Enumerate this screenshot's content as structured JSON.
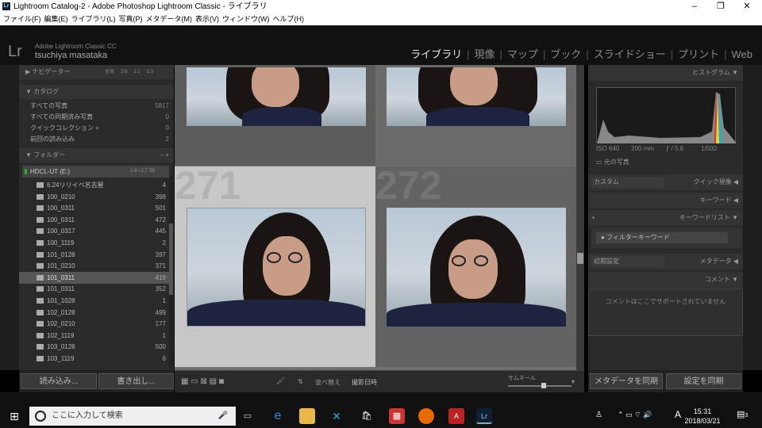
{
  "window": {
    "title": "Lightroom Catalog-2 - Adobe Photoshop Lightroom Classic - ライブラリ",
    "icon_text": "Lr"
  },
  "menu": [
    "ファイル(F)",
    "編集(E)",
    "ライブラリ(L)",
    "写真(P)",
    "メタデータ(M)",
    "表示(V)",
    "ウィンドウ(W)",
    "ヘルプ(H)"
  ],
  "identity": {
    "logo": "Lr",
    "product": "Adobe Lightroom Classic CC",
    "user": "tsuchiya masataka"
  },
  "modules": [
    "ライブラリ",
    "現像",
    "マップ",
    "ブック",
    "スライドショー",
    "プリント",
    "Web"
  ],
  "left": {
    "navigator": "ナビゲーター",
    "nav_zoom": [
      "全体",
      "3:6",
      "1:1",
      "1:3"
    ],
    "catalog_header": "カタログ",
    "catalog": [
      {
        "label": "すべての写真",
        "count": "5817"
      },
      {
        "label": "すべての同期済み写真",
        "count": "0"
      },
      {
        "label": "クイックコレクション +",
        "count": "0"
      },
      {
        "label": "前回の読み込み",
        "count": "2"
      }
    ],
    "folders_header": "フォルダー",
    "volume": {
      "name": "HDCL-UT (E:)",
      "space": "1.9 / 2.7 TB"
    },
    "folders": [
      {
        "name": "6.24リリイベ名古屋",
        "count": "4"
      },
      {
        "name": "100_0210",
        "count": "398"
      },
      {
        "name": "100_0311",
        "count": "501"
      },
      {
        "name": "100_0311",
        "count": "472"
      },
      {
        "name": "100_0317",
        "count": "445"
      },
      {
        "name": "100_1119",
        "count": "2"
      },
      {
        "name": "101_0128",
        "count": "397"
      },
      {
        "name": "101_0210",
        "count": "371"
      },
      {
        "name": "101_0311",
        "count": "419"
      },
      {
        "name": "101_0311",
        "count": "352"
      },
      {
        "name": "101_1028",
        "count": "1"
      },
      {
        "name": "102_0128",
        "count": "499"
      },
      {
        "name": "102_0210",
        "count": "177"
      },
      {
        "name": "102_1119",
        "count": "1"
      },
      {
        "name": "103_0128",
        "count": "500"
      },
      {
        "name": "103_1119",
        "count": "6"
      }
    ],
    "import_btn": "読み込み...",
    "export_btn": "書き出し..."
  },
  "grid": {
    "cells": [
      "271",
      "272"
    ]
  },
  "toolbar": {
    "sort_label": "並べ替え",
    "sort_value": "撮影日時",
    "thumb_label": "サムネール"
  },
  "right": {
    "histogram": "ヒストグラム",
    "exif": [
      "ISO 640",
      "200 mm",
      "ƒ / 5.6",
      "1/500"
    ],
    "original": "元の写真",
    "quick_dev_preset": "カスタム",
    "quick_dev": "クイック現像",
    "keywording": "キーワード",
    "keyword_list": "キーワードリスト",
    "filter_kw": "フィルターキーワード",
    "metadata_preset": "初期設定",
    "metadata": "メタデータ",
    "comments": "コメント",
    "comment_msg": "コメントはここでサポートされていません",
    "sync_meta": "メタデータを同期",
    "sync_settings": "設定を同期"
  },
  "taskbar": {
    "search": "ここに入力して検索",
    "time": "15:31",
    "date": "2018/03/21",
    "ime": "A",
    "notif": "3"
  }
}
